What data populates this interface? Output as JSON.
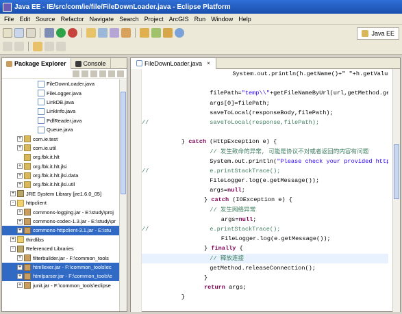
{
  "window": {
    "title": "Java EE - IE/src/com/ie/file/FileDownLoader.java - Eclipse Platform"
  },
  "menu": [
    "File",
    "Edit",
    "Source",
    "Refactor",
    "Navigate",
    "Search",
    "Project",
    "ArcGIS",
    "Run",
    "Window",
    "Help"
  ],
  "perspective": {
    "label": "Java EE"
  },
  "left_tabs": [
    {
      "label": "Package Explorer"
    },
    {
      "label": "Console"
    }
  ],
  "tree": [
    {
      "text": "FileDownLoader.java",
      "indent": 4,
      "icon": "java-file-icon",
      "expand": ""
    },
    {
      "text": "FileLogger.java",
      "indent": 4,
      "icon": "java-file-icon",
      "expand": ""
    },
    {
      "text": "LinkDB.java",
      "indent": 4,
      "icon": "java-file-icon",
      "expand": ""
    },
    {
      "text": "LinkInfo.java",
      "indent": 4,
      "icon": "java-file-icon",
      "expand": ""
    },
    {
      "text": "PdfReader.java",
      "indent": 4,
      "icon": "java-file-icon",
      "expand": ""
    },
    {
      "text": "Queue.java",
      "indent": 4,
      "icon": "java-file-icon",
      "expand": ""
    },
    {
      "text": "com.ie.test",
      "indent": 2,
      "icon": "package-icon",
      "expand": "+"
    },
    {
      "text": "com.ie.util",
      "indent": 2,
      "icon": "package-icon",
      "expand": "+"
    },
    {
      "text": "org.fbk.it.hlt",
      "indent": 2,
      "icon": "package-icon",
      "expand": ""
    },
    {
      "text": "org.fbk.it.hlt.jlsi",
      "indent": 2,
      "icon": "package-icon",
      "expand": "+"
    },
    {
      "text": "org.fbk.it.hlt.jlsi.data",
      "indent": 2,
      "icon": "package-icon",
      "expand": "+"
    },
    {
      "text": "org.fbk.it.hlt.jlsi.util",
      "indent": 2,
      "icon": "package-icon",
      "expand": "+"
    },
    {
      "text": "JRE System Library [jre1.6.0_05]",
      "indent": 1,
      "icon": "library-icon",
      "expand": "+"
    },
    {
      "text": "httpclient",
      "indent": 1,
      "icon": "folder-icon",
      "expand": "-"
    },
    {
      "text": "commons-logging.jar - E:\\study\\proj",
      "indent": 2,
      "icon": "jar-icon",
      "expand": "+"
    },
    {
      "text": "commons-codec-1.3.jar - E:\\study\\pr",
      "indent": 2,
      "icon": "jar-icon",
      "expand": "+"
    },
    {
      "text": "commons-httpclient-3.1.jar - E:\\stu",
      "indent": 2,
      "icon": "jar-icon",
      "expand": "+",
      "selected": true
    },
    {
      "text": "thirdlibs",
      "indent": 1,
      "icon": "folder-icon",
      "expand": "+"
    },
    {
      "text": "Referenced Libraries",
      "indent": 1,
      "icon": "library-icon",
      "expand": "-"
    },
    {
      "text": "filterbuilder.jar - F:\\common_tools",
      "indent": 2,
      "icon": "jar-icon",
      "expand": "+"
    },
    {
      "text": "htmllexer.jar - F:\\common_tools\\ec",
      "indent": 2,
      "icon": "jar-icon",
      "expand": "+",
      "selected": true
    },
    {
      "text": "htmlparser.jar - F:\\common_tools\\e",
      "indent": 2,
      "icon": "jar-icon",
      "expand": "+",
      "selected": true
    },
    {
      "text": "junit.jar - F:\\common_tools\\eclipse",
      "indent": 2,
      "icon": "jar-icon",
      "expand": "+"
    }
  ],
  "editor": {
    "tab_label": "FileDownLoader.java"
  },
  "code_lines": [
    {
      "comment_prefix": "",
      "indent": 16,
      "segments": [
        {
          "t": "System.out.println(h.getName()+\" \"+h.getValue());*/",
          "k": ""
        }
      ]
    },
    {
      "comment_prefix": "",
      "indent": 0,
      "segments": [
        {
          "t": "",
          "k": ""
        }
      ]
    },
    {
      "comment_prefix": "",
      "indent": 12,
      "segments": [
        {
          "t": "filePath=",
          "k": ""
        },
        {
          "t": "\"temp\\\\\"",
          "k": "str"
        },
        {
          "t": "+getFileNameByUrl(url,getMethod.getResponse",
          "k": ""
        }
      ]
    },
    {
      "comment_prefix": "",
      "indent": 12,
      "segments": [
        {
          "t": "args[0]=filePath;",
          "k": ""
        }
      ]
    },
    {
      "comment_prefix": "",
      "indent": 12,
      "segments": [
        {
          "t": "saveToLocal(responseBody,filePath);",
          "k": ""
        }
      ]
    },
    {
      "comment_prefix": "//",
      "indent": 12,
      "segments": [
        {
          "t": "saveToLocal(response,filePath);",
          "k": "cmt"
        }
      ]
    },
    {
      "comment_prefix": "",
      "indent": 0,
      "segments": [
        {
          "t": "",
          "k": ""
        }
      ]
    },
    {
      "comment_prefix": "",
      "indent": 7,
      "segments": [
        {
          "t": "} ",
          "k": ""
        },
        {
          "t": "catch",
          "k": "kw"
        },
        {
          "t": " (HttpException e) {",
          "k": ""
        }
      ]
    },
    {
      "comment_prefix": "",
      "indent": 12,
      "segments": [
        {
          "t": "// 发生致命的异常, 可能是协议不对或者返回的内容有问题",
          "k": "cmt"
        }
      ]
    },
    {
      "comment_prefix": "",
      "indent": 12,
      "segments": [
        {
          "t": "System.out.println(",
          "k": ""
        },
        {
          "t": "\"Please check your provided http address",
          "k": "str"
        }
      ]
    },
    {
      "comment_prefix": "//",
      "indent": 12,
      "segments": [
        {
          "t": "e.printStackTrace();",
          "k": "cmt"
        }
      ]
    },
    {
      "comment_prefix": "",
      "indent": 12,
      "segments": [
        {
          "t": "FileLogger.log(e.getMessage());",
          "k": ""
        }
      ]
    },
    {
      "comment_prefix": "",
      "indent": 12,
      "segments": [
        {
          "t": "args=",
          "k": ""
        },
        {
          "t": "null",
          "k": "kw"
        },
        {
          "t": ";",
          "k": ""
        }
      ]
    },
    {
      "comment_prefix": "",
      "indent": 11,
      "segments": [
        {
          "t": "} ",
          "k": ""
        },
        {
          "t": "catch",
          "k": "kw"
        },
        {
          "t": " (IOException e) {",
          "k": ""
        }
      ]
    },
    {
      "comment_prefix": "",
      "indent": 12,
      "segments": [
        {
          "t": "// 发生网络异常",
          "k": "cmt"
        }
      ]
    },
    {
      "comment_prefix": "",
      "indent": 14,
      "segments": [
        {
          "t": "args=",
          "k": ""
        },
        {
          "t": "null",
          "k": "kw"
        },
        {
          "t": ";",
          "k": ""
        }
      ]
    },
    {
      "comment_prefix": "//",
      "indent": 12,
      "segments": [
        {
          "t": "e.printStackTrace();",
          "k": "cmt"
        }
      ]
    },
    {
      "comment_prefix": "",
      "indent": 14,
      "segments": [
        {
          "t": "FileLogger.log(e.getMessage());",
          "k": ""
        }
      ]
    },
    {
      "comment_prefix": "",
      "indent": 11,
      "segments": [
        {
          "t": "} ",
          "k": ""
        },
        {
          "t": "finally",
          "k": "kw"
        },
        {
          "t": " {",
          "k": ""
        }
      ]
    },
    {
      "comment_prefix": "",
      "indent": 12,
      "segments": [
        {
          "t": "// 释放连接",
          "k": "cmt"
        }
      ],
      "highlight": true
    },
    {
      "comment_prefix": "",
      "indent": 12,
      "segments": [
        {
          "t": "getMethod.releaseConnection();",
          "k": ""
        }
      ]
    },
    {
      "comment_prefix": "",
      "indent": 11,
      "segments": [
        {
          "t": "}",
          "k": ""
        }
      ]
    },
    {
      "comment_prefix": "",
      "indent": 11,
      "segments": [
        {
          "t": "return",
          "k": "kw"
        },
        {
          "t": " args;",
          "k": ""
        }
      ]
    },
    {
      "comment_prefix": "",
      "indent": 7,
      "segments": [
        {
          "t": "}",
          "k": ""
        }
      ]
    }
  ],
  "colors": {
    "title_bar": "#1f5bc4",
    "selection": "#316ac5",
    "keyword": "#7f0055",
    "string": "#2a00ff",
    "comment": "#3f7f5f"
  }
}
